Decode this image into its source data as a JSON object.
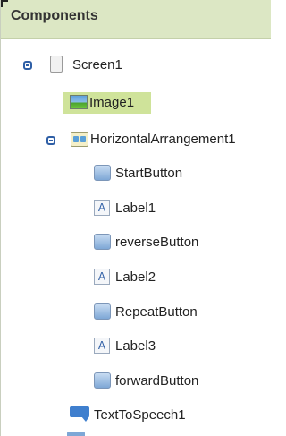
{
  "panel": {
    "title": "Components"
  },
  "tree": {
    "screen": {
      "label": "Screen1",
      "icon": "screen-icon",
      "expanded": true
    },
    "image": {
      "label": "Image1",
      "icon": "image-icon",
      "selected": true
    },
    "arrangement": {
      "label": "HorizontalArrangement1",
      "icon": "horizontal-arrangement-icon",
      "expanded": true
    },
    "children": [
      {
        "label": "StartButton",
        "icon": "button-icon"
      },
      {
        "label": "Label1",
        "icon": "label-icon"
      },
      {
        "label": "reverseButton",
        "icon": "button-icon"
      },
      {
        "label": "Label2",
        "icon": "label-icon"
      },
      {
        "label": "RepeatButton",
        "icon": "button-icon"
      },
      {
        "label": "Label3",
        "icon": "label-icon"
      },
      {
        "label": "forwardButton",
        "icon": "button-icon"
      }
    ],
    "tts": {
      "label": "TextToSpeech1",
      "icon": "text-to-speech-icon"
    }
  },
  "icons": {
    "label_glyph": "A"
  },
  "colors": {
    "header_bg": "#dce7c4",
    "selected_bg": "#cfe39a",
    "toggle": "#2f5fa6"
  }
}
